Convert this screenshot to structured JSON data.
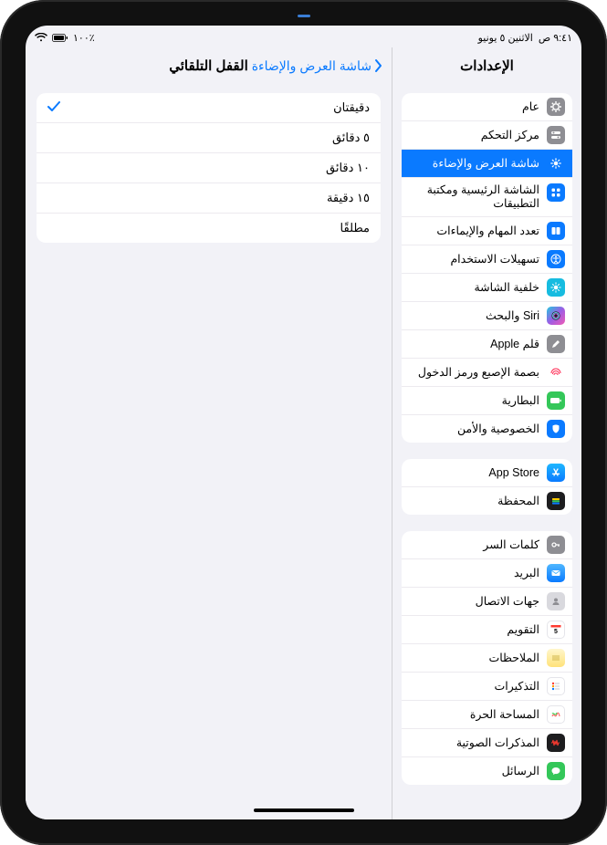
{
  "status": {
    "time": "٩:٤١ ص",
    "date": "الاثنين ٥ يونيو",
    "battery_pct": "٪١٠٠"
  },
  "sidebar": {
    "title": "الإعدادات",
    "groups": [
      {
        "items": [
          {
            "label": "عام",
            "icon_bg": "#8e8e93",
            "icon_name": "gear-icon",
            "selected": false
          },
          {
            "label": "مركز التحكم",
            "icon_bg": "#8e8e93",
            "icon_name": "switches-icon",
            "selected": false
          },
          {
            "label": "شاشة العرض والإضاءة",
            "icon_bg": "#0a7aff",
            "icon_name": "brightness-icon",
            "selected": true
          },
          {
            "label": "الشاشة الرئيسية ومكتبة التطبيقات",
            "icon_bg": "#0a7aff",
            "icon_name": "home-grid-icon",
            "selected": false,
            "multiline": true
          },
          {
            "label": "تعدد المهام والإيماءات",
            "icon_bg": "#0a7aff",
            "icon_name": "multitask-icon",
            "selected": false
          },
          {
            "label": "تسهيلات الاستخدام",
            "icon_bg": "#0a7aff",
            "icon_name": "accessibility-icon",
            "selected": false
          },
          {
            "label": "خلفية الشاشة",
            "icon_bg": "#17bce0",
            "icon_name": "wallpaper-icon",
            "selected": false
          },
          {
            "label": "Siri والبحث",
            "icon_bg": "#1d1d1f",
            "icon_name": "siri-icon",
            "selected": false
          },
          {
            "label": "قلم Apple",
            "icon_bg": "#8e8e93",
            "icon_name": "pencil-icon",
            "selected": false
          },
          {
            "label": "بصمة الإصبع ورمز الدخول",
            "icon_bg": "#ff3b30",
            "icon_name": "touchid-icon",
            "selected": false
          },
          {
            "label": "البطارية",
            "icon_bg": "#34c759",
            "icon_name": "battery-icon",
            "selected": false
          },
          {
            "label": "الخصوصية والأمن",
            "icon_bg": "#0a7aff",
            "icon_name": "privacy-icon",
            "selected": false
          }
        ]
      },
      {
        "items": [
          {
            "label": "App Store",
            "icon_bg": "#1f8fff",
            "icon_name": "appstore-icon",
            "selected": false
          },
          {
            "label": "المحفظة",
            "icon_bg": "#1d1d1f",
            "icon_name": "wallet-icon",
            "selected": false
          }
        ]
      },
      {
        "items": [
          {
            "label": "كلمات السر",
            "icon_bg": "#8e8e93",
            "icon_name": "key-icon",
            "selected": false
          },
          {
            "label": "البريد",
            "icon_bg": "#1f8fff",
            "icon_name": "mail-icon",
            "selected": false
          },
          {
            "label": "جهات الاتصال",
            "icon_bg": "#d9d9de",
            "icon_name": "contacts-icon",
            "selected": false
          },
          {
            "label": "التقويم",
            "icon_bg": "#ffffff",
            "icon_name": "calendar-icon",
            "selected": false
          },
          {
            "label": "الملاحظات",
            "icon_bg": "#ffd54a",
            "icon_name": "notes-icon",
            "selected": false
          },
          {
            "label": "التذكيرات",
            "icon_bg": "#ffffff",
            "icon_name": "reminders-icon",
            "selected": false
          },
          {
            "label": "المساحة الحرة",
            "icon_bg": "#ffffff",
            "icon_name": "freeform-icon",
            "selected": false
          },
          {
            "label": "المذكرات الصوتية",
            "icon_bg": "#1d1d1f",
            "icon_name": "voice-memos-icon",
            "selected": false
          },
          {
            "label": "الرسائل",
            "icon_bg": "#34c759",
            "icon_name": "messages-icon",
            "selected": false
          }
        ]
      }
    ]
  },
  "detail": {
    "back_label": "شاشة العرض والإضاءة",
    "title": "القفل التلقائي",
    "options": [
      {
        "label": "دقيقتان",
        "checked": true
      },
      {
        "label": "٥ دقائق",
        "checked": false
      },
      {
        "label": "١٠ دقائق",
        "checked": false
      },
      {
        "label": "١٥ دقيقة",
        "checked": false
      },
      {
        "label": "مطلقًا",
        "checked": false
      }
    ]
  }
}
